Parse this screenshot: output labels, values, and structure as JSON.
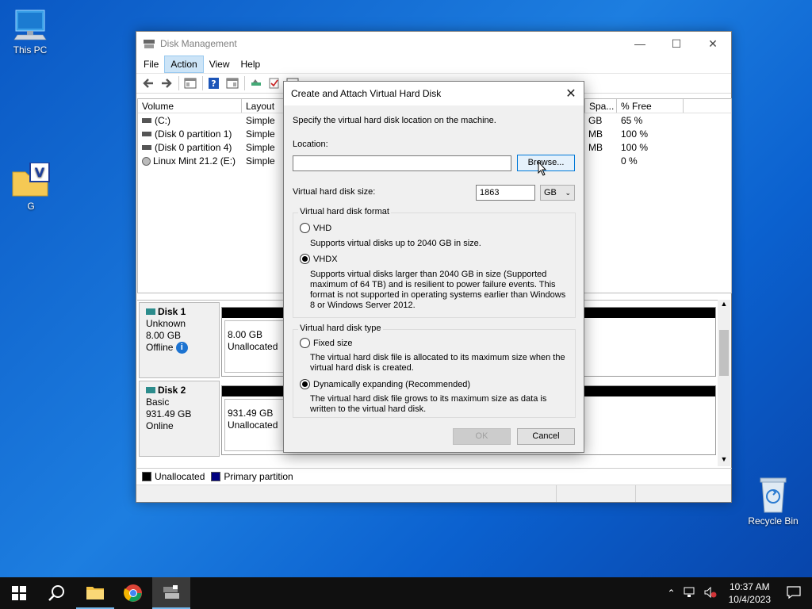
{
  "desktop": {
    "icons": [
      {
        "label": "This PC"
      },
      {
        "label": "G"
      },
      {
        "label": "Recycle Bin"
      }
    ]
  },
  "window": {
    "title": "Disk Management",
    "menu": [
      "File",
      "Action",
      "View",
      "Help"
    ],
    "active_menu": "Action",
    "volume_columns": [
      "Volume",
      "Layout",
      "Spa...",
      "% Free"
    ],
    "volumes": [
      {
        "name": "(C:)",
        "layout": "Simple",
        "space": "GB",
        "free": "65 %"
      },
      {
        "name": "(Disk 0 partition 1)",
        "layout": "Simple",
        "space": "MB",
        "free": "100 %"
      },
      {
        "name": "(Disk 0 partition 4)",
        "layout": "Simple",
        "space": "MB",
        "free": "100 %"
      },
      {
        "name": "Linux Mint 21.2 (E:)",
        "layout": "Simple",
        "space": "",
        "free": "0 %"
      }
    ],
    "disks": [
      {
        "name": "Disk 1",
        "type": "Unknown",
        "size": "8.00 GB",
        "status": "Offline",
        "part_size": "8.00 GB",
        "part_state": "Unallocated"
      },
      {
        "name": "Disk 2",
        "type": "Basic",
        "size": "931.49 GB",
        "status": "Online",
        "part_size": "931.49 GB",
        "part_state": "Unallocated"
      }
    ],
    "legend": [
      {
        "label": "Unallocated",
        "color": "#000000"
      },
      {
        "label": "Primary partition",
        "color": "#000080"
      }
    ]
  },
  "dialog": {
    "title": "Create and Attach Virtual Hard Disk",
    "instruction": "Specify the virtual hard disk location on the machine.",
    "location_label": "Location:",
    "location_value": "",
    "browse_label": "Browse...",
    "size_label": "Virtual hard disk size:",
    "size_value": "1863",
    "size_unit": "GB",
    "format_group": "Virtual hard disk format",
    "vhd_label": "VHD",
    "vhd_desc": "Supports virtual disks up to 2040 GB in size.",
    "vhdx_label": "VHDX",
    "vhdx_desc": "Supports virtual disks larger than 2040 GB in size (Supported maximum of 64 TB) and is resilient to power failure events. This format is not supported in operating systems earlier than Windows 8 or Windows Server 2012.",
    "format_selected": "VHDX",
    "type_group": "Virtual hard disk type",
    "fixed_label": "Fixed size",
    "fixed_desc": "The virtual hard disk file is allocated to its maximum size when the virtual hard disk is created.",
    "dynamic_label": "Dynamically expanding (Recommended)",
    "dynamic_desc": "The virtual hard disk file grows to its maximum size as data is written to the virtual hard disk.",
    "type_selected": "Dynamically expanding",
    "ok_label": "OK",
    "cancel_label": "Cancel"
  },
  "taskbar": {
    "time": "10:37 AM",
    "date": "10/4/2023",
    "pinned": [
      "start-icon",
      "search-icon",
      "file-explorer-icon",
      "chrome-icon",
      "disk-management-icon"
    ]
  }
}
